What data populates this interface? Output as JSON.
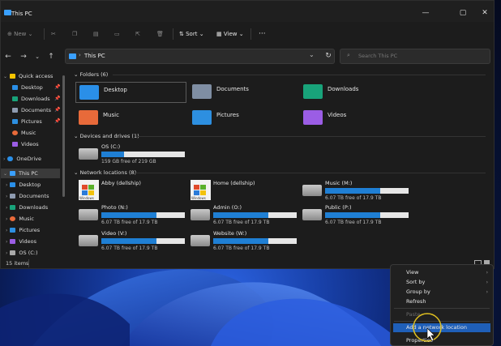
{
  "window": {
    "title": "This PC"
  },
  "toolbar": {
    "new": "New",
    "sort": "Sort",
    "view": "View",
    "more": "···"
  },
  "address": {
    "path": "This PC",
    "search_placeholder": "Search This PC"
  },
  "sidebar": {
    "items": [
      {
        "label": "Quick access",
        "pinned": false
      },
      {
        "label": "Desktop",
        "pinned": true
      },
      {
        "label": "Downloads",
        "pinned": true
      },
      {
        "label": "Documents",
        "pinned": true
      },
      {
        "label": "Pictures",
        "pinned": true
      },
      {
        "label": "Music",
        "pinned": false
      },
      {
        "label": "Videos",
        "pinned": false
      },
      {
        "label": "OneDrive",
        "pinned": false
      },
      {
        "label": "This PC",
        "pinned": false
      },
      {
        "label": "Desktop",
        "pinned": false
      },
      {
        "label": "Documents",
        "pinned": false
      },
      {
        "label": "Downloads",
        "pinned": false
      },
      {
        "label": "Music",
        "pinned": false
      },
      {
        "label": "Pictures",
        "pinned": false
      },
      {
        "label": "Videos",
        "pinned": false
      },
      {
        "label": "OS (C:)",
        "pinned": false
      }
    ]
  },
  "groups": {
    "folders": "Folders (6)",
    "devices": "Devices and drives (1)",
    "network": "Network locations (8)"
  },
  "folders": [
    {
      "name": "Desktop",
      "color": "#2a8fe8"
    },
    {
      "name": "Documents",
      "color": "#7f8ea3"
    },
    {
      "name": "Downloads",
      "color": "#18a37a"
    },
    {
      "name": "Music",
      "color": "#e86a3a"
    },
    {
      "name": "Pictures",
      "color": "#2d8fe0"
    },
    {
      "name": "Videos",
      "color": "#9b5de5"
    }
  ],
  "drives": [
    {
      "name": "OS (C:)",
      "free": "159 GB free of 219 GB",
      "used_fraction": 0.27
    }
  ],
  "network": [
    {
      "name": "Abby (dellship)",
      "logo": "Windows"
    },
    {
      "name": "Home (dellship)",
      "logo": "Windows"
    },
    {
      "name": "Music (M:)",
      "free": "6.07 TB free of 17.9 TB",
      "used_fraction": 0.66
    },
    {
      "name": "Photo (N:)",
      "free": "6.07 TB free of 17.9 TB",
      "used_fraction": 0.66
    },
    {
      "name": "Admin (O:)",
      "free": "6.07 TB free of 17.9 TB",
      "used_fraction": 0.66
    },
    {
      "name": "Public (P:)",
      "free": "6.07 TB free of 17.9 TB",
      "used_fraction": 0.66
    },
    {
      "name": "Video (V:)",
      "free": "6.07 TB free of 17.9 TB",
      "used_fraction": 0.66
    },
    {
      "name": "Website (W:)",
      "free": "6.07 TB free of 17.9 TB",
      "used_fraction": 0.66
    }
  ],
  "status": {
    "count": "15 items"
  },
  "context_menu": [
    {
      "label": "View",
      "submenu": true,
      "disabled": false,
      "highlight": false
    },
    {
      "label": "Sort by",
      "submenu": true,
      "disabled": false,
      "highlight": false
    },
    {
      "label": "Group by",
      "submenu": true,
      "disabled": false,
      "highlight": false
    },
    {
      "label": "Refresh",
      "submenu": false,
      "disabled": false,
      "highlight": false
    },
    {
      "label": "Paste",
      "submenu": false,
      "disabled": true,
      "highlight": false
    },
    {
      "label": "Add a network location",
      "submenu": false,
      "disabled": false,
      "highlight": true
    },
    {
      "label": "Properties",
      "submenu": false,
      "disabled": false,
      "highlight": false
    }
  ]
}
